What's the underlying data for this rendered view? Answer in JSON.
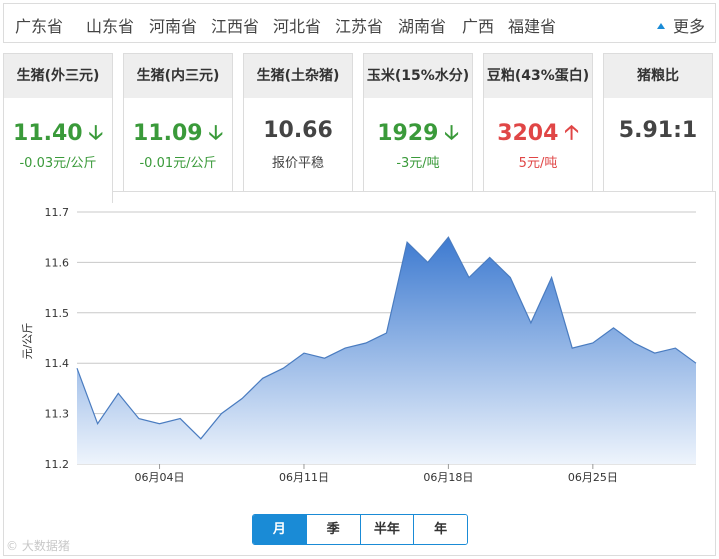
{
  "provinces": [
    "广东省",
    "山东省",
    "河南省",
    "江西省",
    "河北省",
    "江苏省",
    "湖南省",
    "广西",
    "福建省"
  ],
  "more_label": "更多",
  "cards": [
    {
      "title": "生猪(外三元)",
      "value": "11.40",
      "change": "-0.03元/公斤",
      "trend": "down",
      "color": "#3a9a3a"
    },
    {
      "title": "生猪(内三元)",
      "value": "11.09",
      "change": "-0.01元/公斤",
      "trend": "down",
      "color": "#3a9a3a"
    },
    {
      "title": "生猪(土杂猪)",
      "value": "10.66",
      "change": "报价平稳",
      "trend": "flat",
      "color": "#444444"
    },
    {
      "title": "玉米(15%水分)",
      "value": "1929",
      "change": "-3元/吨",
      "trend": "down",
      "color": "#3a9a3a"
    },
    {
      "title": "豆粕(43%蛋白)",
      "value": "3204",
      "change": "5元/吨",
      "trend": "up",
      "color": "#e04646"
    },
    {
      "title": "猪粮比",
      "value": "5.91:1",
      "change": "",
      "trend": "none",
      "color": "#444444"
    }
  ],
  "chart_data": {
    "type": "area",
    "ylabel": "元/公斤",
    "ylim": [
      11.2,
      11.7
    ],
    "yticks": [
      "11.7",
      "11.6",
      "11.5",
      "11.4",
      "11.3",
      "11.2"
    ],
    "xticks": [
      "06月04日",
      "06月11日",
      "06月18日",
      "06月25日"
    ],
    "x": [
      "05月31日",
      "06月01日",
      "06月02日",
      "06月03日",
      "06月04日",
      "06月05日",
      "06月06日",
      "06月07日",
      "06月08日",
      "06月09日",
      "06月10日",
      "06月11日",
      "06月12日",
      "06月13日",
      "06月14日",
      "06月15日",
      "06月16日",
      "06月17日",
      "06月18日",
      "06月19日",
      "06月20日",
      "06月21日",
      "06月22日",
      "06月23日",
      "06月24日",
      "06月25日",
      "06月26日",
      "06月27日",
      "06月28日",
      "06月29日",
      "06月30日"
    ],
    "series": [
      {
        "values": [
          11.39,
          11.28,
          11.34,
          11.29,
          11.28,
          11.29,
          11.25,
          11.3,
          11.33,
          11.37,
          11.39,
          11.42,
          11.41,
          11.43,
          11.44,
          11.46,
          11.64,
          11.6,
          11.65,
          11.57,
          11.61,
          11.57,
          11.48,
          11.57,
          11.43,
          11.44,
          11.47,
          11.44,
          11.42,
          11.43,
          11.4
        ]
      }
    ],
    "line_color": "#4a7cc0",
    "fill_top": "#3d7ad0",
    "fill_bottom": "#eef4fc",
    "grid": true
  },
  "range_tabs": [
    "月",
    "季",
    "半年",
    "年"
  ],
  "selected_range": "月",
  "watermark": "© 大数据猪"
}
